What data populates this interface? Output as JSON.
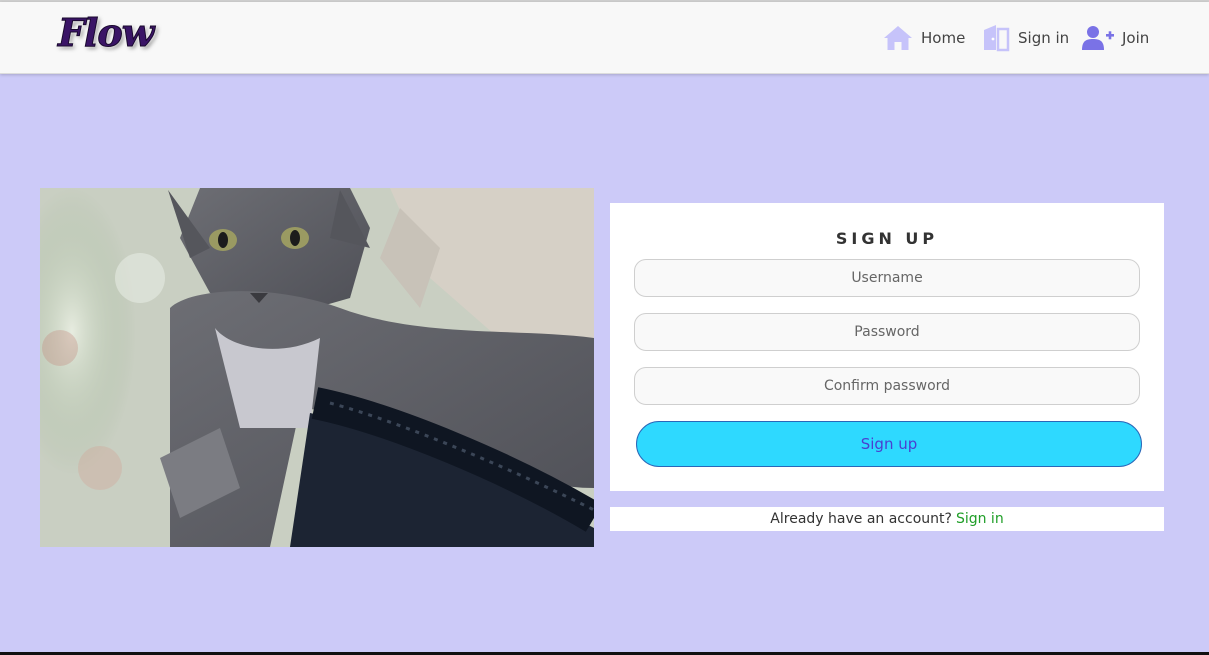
{
  "brand": {
    "logo_text": "Flow"
  },
  "nav": {
    "home": {
      "label": "Home",
      "icon": "home-icon"
    },
    "signin": {
      "label": "Sign in",
      "icon": "door-icon"
    },
    "join": {
      "label": "Join",
      "icon": "user-plus-icon"
    }
  },
  "hero": {
    "image": "gray-cat-on-chair-photo"
  },
  "form": {
    "title": "SIGN UP",
    "username_placeholder": "Username",
    "password_placeholder": "Password",
    "confirm_placeholder": "Confirm password",
    "submit_label": "Sign up"
  },
  "footer": {
    "prompt": "Already have an account?",
    "link_label": "Sign in"
  },
  "colors": {
    "page_background": "#cccaf8",
    "button_fill": "#2ed9ff",
    "link_green": "#1f9e27",
    "icon_lavender": "#c6c3fa",
    "icon_purple": "#7a72e6"
  }
}
